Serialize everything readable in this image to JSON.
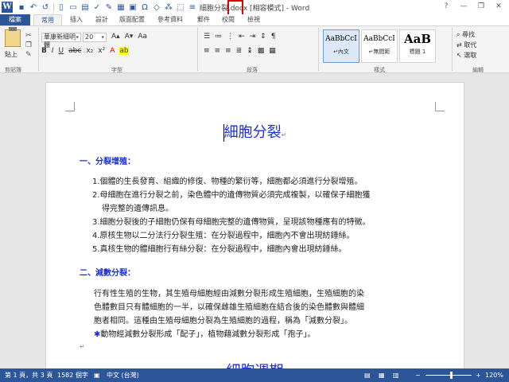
{
  "window": {
    "title": "細胞分裂.docx [相容模式] - Word",
    "controls": [
      "?",
      "—",
      "❐",
      "✕"
    ]
  },
  "qat": [
    "save-icon",
    "undo-icon",
    "redo-icon",
    "new-icon",
    "open-icon",
    "print-icon",
    "spelling-icon",
    "format-painter-icon",
    "table-icon",
    "picture-icon",
    "symbol-icon",
    "shapes-icon",
    "select-icon",
    "customize-icon"
  ],
  "tabs": [
    "檔案",
    "常用",
    "插入",
    "設計",
    "版面配置",
    "參考資料",
    "郵件",
    "校閱",
    "檢視"
  ],
  "ribbon": {
    "clipboard": {
      "paste_label": "貼上",
      "group_label": "剪貼簿"
    },
    "font": {
      "font_name": "華康新細明體",
      "font_size": "20",
      "group_label": "字型"
    },
    "paragraph": {
      "group_label": "段落"
    },
    "styles": {
      "items": [
        {
          "preview": "AaBbCcI",
          "name": "↵內文"
        },
        {
          "preview": "AaBbCcI",
          "name": "↵無間距"
        },
        {
          "preview": "AaB",
          "name": "標題 1"
        }
      ],
      "group_label": "樣式"
    },
    "editing": {
      "find": "尋找",
      "replace": "取代",
      "select": "選取",
      "group_label": "編輯"
    }
  },
  "document": {
    "title": "細胞分裂",
    "section1": {
      "heading": "一、分裂增殖：",
      "items": [
        "1.個體的生長發育、組織的修復、物種的繁衍等，細胞都必須進行分裂增殖。",
        "2.母細胞在進行分裂之前，染色體中的遺傳物質必須完成複製，以確保子細胞獲",
        "得完整的遺傳訊息。",
        "3.細胞分裂後的子細胞仍保有母細胞完整的遺傳物質，呈現該物種應有的特徵。",
        "4.原核生物以二分法行分裂生殖：在分裂過程中，細胞內不會出現紡錘絲。",
        "5.真核生物的體細胞行有絲分裂：在分裂過程中，細胞內會出現紡錘絲。"
      ]
    },
    "section2": {
      "heading": "二、減數分裂：",
      "lines": [
        "行有性生殖的生物，其生殖母細胞經由減數分裂形成生殖細胞，生殖細胞的染",
        "色體數目只有體細胞的一半，以確保雌雄生殖細胞在結合後的染色體數與體細",
        "胞者相同。這種由生殖母細胞分裂為生殖細胞的過程，稱為「減數分裂」。"
      ],
      "note": "動物經減數分裂形成「配子」，植物藉減數分裂形成「孢子」。"
    },
    "next_title": "細胞週期"
  },
  "status": {
    "page": "第 1 頁，共 3 頁",
    "words": "1582 個字",
    "language": "中文 (台灣)",
    "zoom": "120%"
  }
}
